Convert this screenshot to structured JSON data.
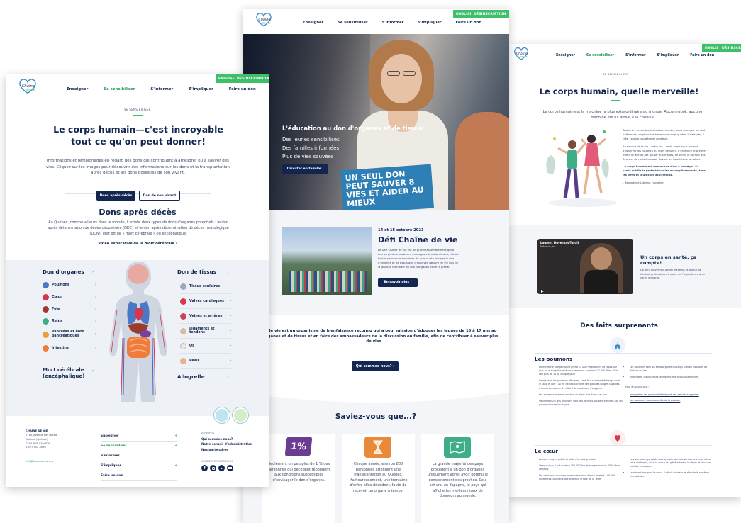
{
  "card1": {
    "lang_en": "ENGLISH",
    "lang_reg": "DÉSINSCRIPTION",
    "logo": "Chaîne de vie",
    "nav": [
      "Enseigner",
      "Se sensibiliser",
      "S'informer",
      "S'impliquer",
      "Faire un don"
    ],
    "eyebrow": "SE SENSIBILISER",
    "title": "Le corps humain—c'est incroyable tout ce qu'on peut donner!",
    "intro": "Informations et témoignages en regard des dons qui contribuent à améliorer ou à sauver des vies. Cliquez sur les images pour découvrir des informations sur les dons et la transplantation après décès et les dons possibles de son vivant.",
    "tab_active": "Dons après décès",
    "tab_other": "Don de son vivant",
    "section_title": "Dons après décès",
    "section_text": "Au Québec, comme ailleurs dans le monde, il existe deux types de dons d'organes potentiels : le don après détermination de décès circulatoire (DDC) et le don après détermination de décès neurologique (DDN), état dit de « mort cérébrale » ou encéphalique.",
    "video_link": "Vidéo explicative de la mort cérébrale ›",
    "organs_title": "Don d'organes",
    "organs": [
      "Poumons",
      "Cœur",
      "Foie",
      "Reins",
      "Pancréas et îlots pancréatiques",
      "Intestins"
    ],
    "brain_death": "Mort cérébrale (encéphalique)",
    "tissues_title": "Don de tissus",
    "tissues": [
      "Tissus oculaires",
      "Valves cardiaques",
      "Veines et artères",
      "Ligaments et tendons",
      "Os",
      "Peau"
    ],
    "allograft": "Allogreffe",
    "footer_org": "CHAÎNE DE VIE",
    "footer_address": [
      "2110, avenue des Hôtels",
      "Québec (Québec)",
      "G1W 4W5 CANADA",
      "1 877 353-5094"
    ],
    "footer_email": "info@chainedevie.org",
    "footer_menu": [
      "Enseigner",
      "Se sensibiliser",
      "S'informer",
      "S'impliquer",
      "Faire un don"
    ],
    "footer_about_title": "À PROPOS",
    "footer_about": [
      "Qui sommes-nous?",
      "Notre conseil d'administration",
      "Nos partenaires"
    ],
    "footer_social_title": "CONNECTEZ AVEC NOUS"
  },
  "card2": {
    "lang_en": "ENGLISH",
    "lang_reg": "DÉSINSCRIPTION",
    "nav": [
      "Enseigner",
      "Se sensibiliser",
      "S'informer",
      "S'impliquer",
      "Faire un don"
    ],
    "hero_title": "L'éducation au don d'organes et de tissus:",
    "hero_lines": [
      "Des jeunes sensibilisés",
      "Des familles informées",
      "Plus de vies sauvées"
    ],
    "hero_btn": "Discuter en famille ›",
    "sign_text": "UN SEUL DON PEUT SAUVER 8 VIES ET AIDER AU MIEUX",
    "event_date": "14 et 15 octobre 2023",
    "event_title": "Défi Chaîne de vie",
    "event_text": "Le Défi Chaîne de vie est un grand rassemblement qui a lieu au pied de plusieurs montagnes simultanément, reliant toutes personnes touchées de près ou de loin par le don d'organes et de tissus afin d'appuyer l'œuvre de vie lors de la journée mondiale du don d'organes et de la greffe.",
    "event_btn": "En savoir plus ›",
    "mission_text": "Chaîne de vie est un organisme de bienfaisance reconnu qui a pour mission d'éduquer les jeunes de 15 à 17 ans au don d'organes et de tissus et en faire des ambassadeurs de la discussion en famille, afin de contribuer à sauver plus de vies.",
    "mission_btn": "Qui sommes-nous? ›",
    "facts_title": "Saviez-vous que...?",
    "fact1": "Seulement un peu plus de 1 % des personnes qui décèdent répondent aux conditions susceptibles d'envisager le don d'organes.",
    "fact2": "Chaque année, environ 800 personnes attendent une transplantation au Québec. Malheureusement, une trentaine d'entre elles décèdent, faute de recevoir un organe à temps.",
    "fact3": "La grande majorité des pays procèdent à un don d'organes uniquement après avoir obtenu le consentement des proches. Cela est vrai en Espagne, le pays qui affiche les meilleurs taux de donneurs au monde.",
    "pct": "1%"
  },
  "card3": {
    "lang_en": "ENGLISH",
    "lang_reg": "DÉSINSCRIPTION",
    "nav": [
      "Enseigner",
      "Se sensibiliser",
      "S'informer",
      "S'impliquer",
      "Faire un don"
    ],
    "eyebrow": "SE SENSIBILISER",
    "title": "Le corps humain, quelle merveille!",
    "intro": "Le corps humain est la machine la plus extraordinaire au monde. Aucun robot, aucune machine, ne lui arrive à la cheville.",
    "para1": "Toutes les secondes, toutes les minutes, sans manquer un seul battement, vingt-quatre heures sur vingt-quatre, il s'adapte, il crée, respire, oxygène et construit.",
    "para2": "Au service de la vie – notre vie – cette corps nous permet d'observer les couleurs du lever de soleil, d'entendre le premier mot d'un enfant, de goûter aux fraises, de sentir le parfum des fleurs et de nous émouvoir devant les beautés de la nature.",
    "para3": "Le corps humain est une œuvre d'art à protéger. Sa santé mérite la perte à tous les accomplissements, tous les défis et toutes les aspirations.",
    "quote_author": "– Bernadette Leblanc, humaine",
    "video_title": "Laurent Duvernay-Tardif",
    "video_sub": "Médecin, ex",
    "video_heading": "Un corps en santé, ça compte!",
    "video_text": "Laurent Duvernay-Tardif (médecin et joueur de football professionnel) parle de l'importance d'un corps en santé.",
    "facts_title": "Des faits surprenants",
    "lungs_title": "Les poumons",
    "lungs_left": [
      "En moyenne une personne prend 22 000 respirations de repos par jour, ce qui signifie qu'à nous respirons au moins 11 000 litres d'air, soit plus de 11 kg chaque jour!",
      "Ce qui rend les poumons efficaces, c'est leur surface d'échange entre le sang et l'air : 70 m² de capillaires et des globules rouges capables d'emporter chacun 1 milliard de molécules d'oxygène.",
      "Les poumons expirent environ un demi-litre d'eau par jour.",
      "Seulement 2% des poumons sont des déchets qui sont éliminés par les poumons lorsqu'on expire."
    ],
    "lungs_right": [
      "Les poumons sont les seuls organes du corps humain capables de flotter sur l'eau.",
      "Incroyable! les poumons fabriquent des cellules sanguines.",
      "Incroyable : les poumons fabriquent des cellules sanguines",
      "Les poumons : une merveille de la création"
    ],
    "lungs_more": "Pour en savoir plus :",
    "heart_title": "Le cœur",
    "heart_left": [
      "Le cœur moyen est de la taille d'un poing adulte.",
      "Chaque jour, il bat environ 100 000 fois et pompe environ 7500 litres de sang.",
      "Les vaisseaux du corps humain mis bout à bout feraient 100 000 kilomètres, soit deux fois et demie le tour de la Terre."
    ],
    "heart_right": [
      "Le cœur brisé, ça existe. Les symptômes sont similaires à ceux d'une crise cardiaque, mais la cause est généralement le stress et non une maladie cardiaque.",
      "Le rire est bon pour le cœur. Il réduit le stress et stimule le système immunitaire."
    ]
  },
  "colors": {
    "navy": "#12264f",
    "green": "#3fbf6a",
    "light_bg": "#f3f5f9"
  }
}
